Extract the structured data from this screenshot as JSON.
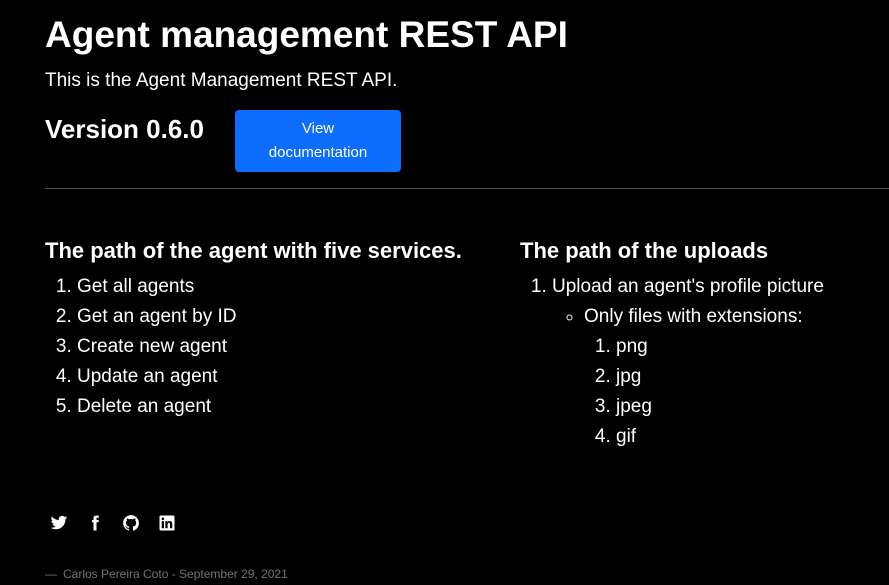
{
  "page": {
    "title": "Agent management REST API",
    "intro": "This is the Agent Management REST API.",
    "version": "Version 0.6.0",
    "doc_button": "View documentation"
  },
  "sections": {
    "agents": {
      "heading": "The path of the agent with five services.",
      "items": [
        "Get all agents",
        "Get an agent by ID",
        "Create new agent",
        "Update an agent",
        "Delete an agent"
      ]
    },
    "uploads": {
      "heading": "The path of the uploads",
      "item": "Upload an agent's profile picture",
      "sub_item": "Only files with extensions:",
      "extensions": [
        "png",
        "jpg",
        "jpeg",
        "gif"
      ]
    }
  },
  "social_icons": [
    "twitter-icon",
    "facebook-icon",
    "github-icon",
    "linkedin-icon"
  ],
  "footer": {
    "dash": "—",
    "credit": "Carlos Pereira Coto - September 29, 2021"
  },
  "colors": {
    "background": "#000000",
    "text": "#ffffff",
    "button": "#0d6efd",
    "divider": "#4d4d4d",
    "muted": "#6c757d"
  }
}
